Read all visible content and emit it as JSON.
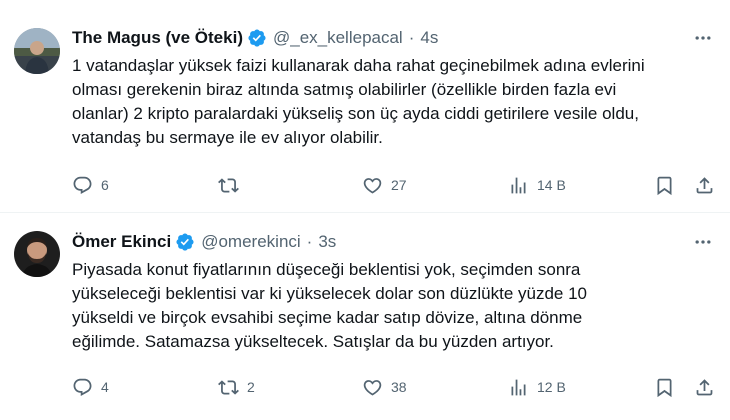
{
  "tweets": [
    {
      "name": "The Magus (ve Öteki)",
      "handle": "@_ex_kellepacal",
      "separator": "·",
      "time": "4s",
      "text": "1 vatandaşlar yüksek faizi kullanarak daha rahat geçinebilmek adına evlerini\nolması gerekenin biraz altında satmış olabilirler (özellikle birden fazla evi\nolanlar) 2 kripto paralardaki yükseliş son üç ayda ciddi getirilere vesile oldu,\nvatandaş bu sermaye ile ev alıyor olabilir.",
      "replies": "6",
      "retweets": "",
      "likes": "27",
      "views": "14 B",
      "avatar_icon": "profile-photo-man-outdoors"
    },
    {
      "name": "Ömer Ekinci",
      "handle": "@omerekinci",
      "separator": "·",
      "time": "3s",
      "text": "Piyasada konut fiyatlarının düşeceği beklentisi yok, seçimden sonra\nyükseleceği beklentisi var ki yükselecek dolar son düzlükte yüzde 10\nyükseldi ve birçok evsahibi seçime kadar satıp dövize, altına dönme\neğilimde. Satamazsa yükseltecek. Satışlar da bu yüzden artıyor.",
      "replies": "4",
      "retweets": "2",
      "likes": "38",
      "views": "12 B",
      "avatar_icon": "profile-photo-bearded-man"
    }
  ],
  "colors": {
    "verified": "#1d9bf0",
    "text": "#0f1419",
    "secondary": "#536471",
    "divider": "#eff3f4"
  },
  "icons": {
    "verified": "verified-badge-icon",
    "more": "more-options-icon",
    "reply": "reply-icon",
    "retweet": "retweet-icon",
    "like": "like-icon",
    "views": "views-icon",
    "bookmark": "bookmark-icon",
    "share": "share-icon"
  }
}
